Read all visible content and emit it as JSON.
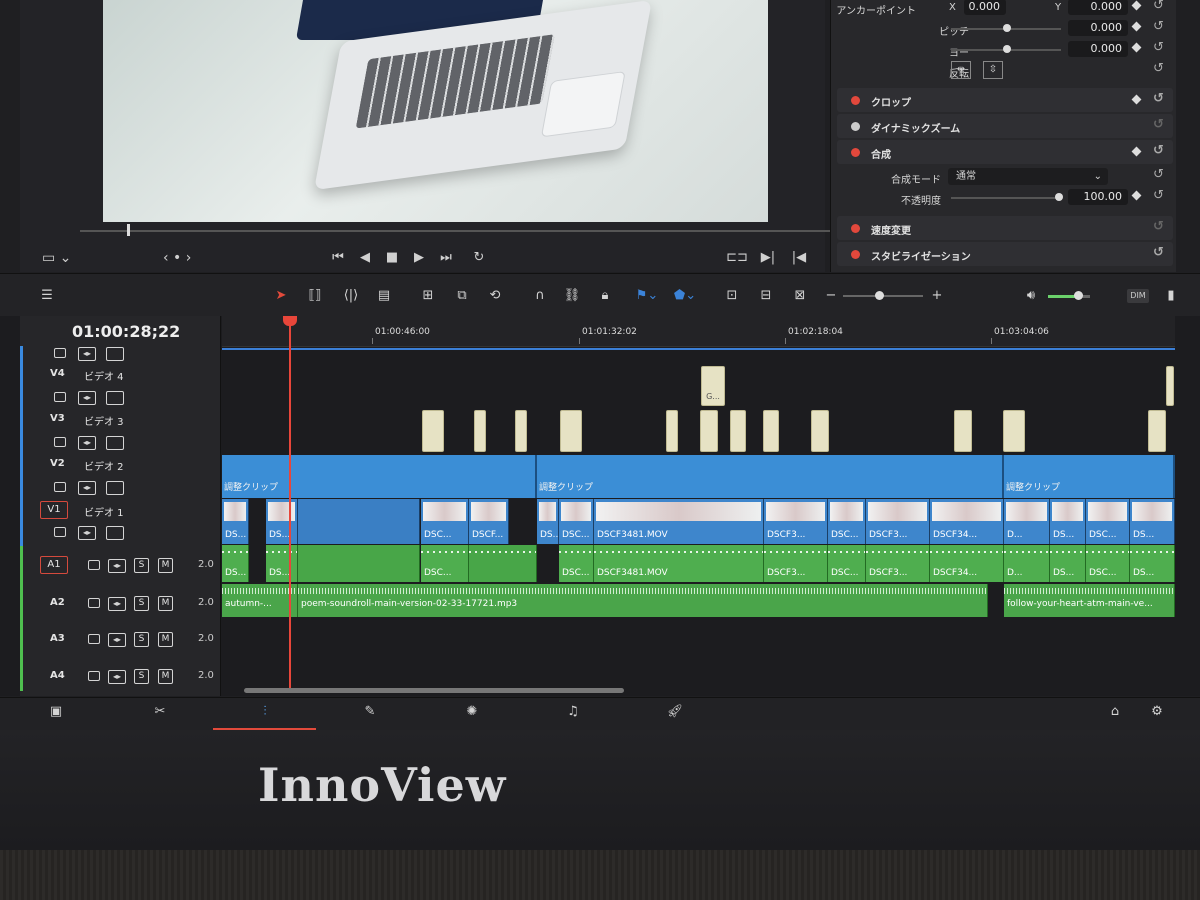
{
  "brand": "InnoView",
  "viewer": {
    "transport_icons": [
      "skip-back-icon",
      "play-reverse-icon",
      "stop-icon",
      "play-icon",
      "skip-forward-icon",
      "loop-icon"
    ],
    "nav": "‹ • ›"
  },
  "inspector": {
    "anchor_label": "アンカーポイント",
    "x_label": "X",
    "x_value": "0.000",
    "y_label": "Y",
    "y_value": "0.000",
    "pitch_label": "ピッチ",
    "pitch_value": "0.000",
    "yaw_label": "ヨー",
    "yaw_value": "0.000",
    "flip_label": "反転",
    "sections": {
      "crop": "クロップ",
      "dynamic_zoom": "ダイナミックズーム",
      "composite": "合成",
      "speed": "速度変更",
      "stabilize": "スタビライゼーション"
    },
    "composite_mode_label": "合成モード",
    "composite_mode_value": "通常",
    "opacity_label": "不透明度",
    "opacity_value": "100.00"
  },
  "toolbar": {
    "dim_label": "DIM",
    "zoom_minus": "−",
    "zoom_plus": "+"
  },
  "timeline": {
    "timecode": "01:00:28;22",
    "ruler": [
      "01:00:46:00",
      "01:01:32:02",
      "01:02:18:04",
      "01:03:04:06"
    ],
    "tracks": {
      "v4": {
        "name": "V4",
        "label": "ビデオ 4"
      },
      "v3": {
        "name": "V3",
        "label": "ビデオ 3"
      },
      "v2": {
        "name": "V2",
        "label": "ビデオ 2"
      },
      "v1": {
        "name": "V1",
        "label": "ビデオ 1"
      },
      "a1": {
        "name": "A1",
        "vol": "2.0"
      },
      "a2": {
        "name": "A2",
        "vol": "2.0"
      },
      "a3": {
        "name": "A3",
        "vol": "2.0"
      },
      "a4": {
        "name": "A4",
        "vol": "2.0"
      }
    },
    "s_label": "S",
    "m_label": "M",
    "adjustment": "調整クリップ",
    "v4_clip": "G...",
    "video_clips": [
      "DS...",
      "DS...",
      "DS...",
      "DSC...",
      "DSCF...",
      "DSC...",
      "DSCF3481.MOV",
      "DSCF3...",
      "DSC...",
      "DSCF3...",
      "DSCF34...",
      "D...",
      "DS...",
      "DSC...",
      "DS..."
    ],
    "audio_clips": [
      "DS...",
      "DS...",
      "DSC...",
      "DSC...",
      "DSCF3481.MOV",
      "DSCF3...",
      "DSC...",
      "DSCF3...",
      "DSCF34...",
      "D...",
      "DS...",
      "DSC...",
      "DS..."
    ],
    "a2_clips": [
      "autumn-...",
      "poem-soundroll-main-version-02-33-17721.mp3",
      "follow-your-heart-atm-main-ve..."
    ]
  }
}
